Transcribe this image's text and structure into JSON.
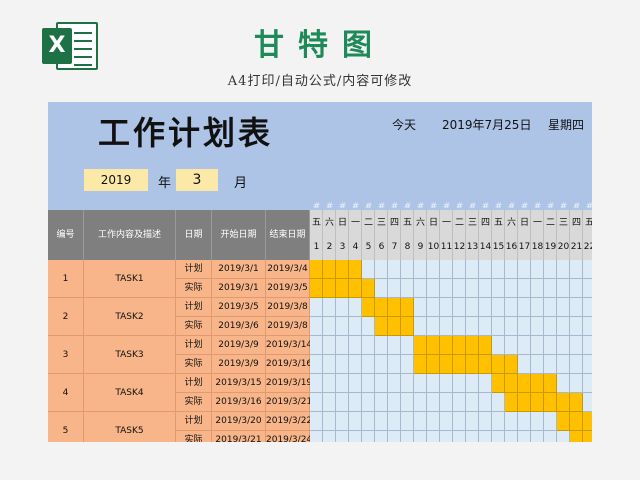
{
  "header": {
    "logo_letter": "X",
    "title": "甘特图",
    "subtitle": "A4打印/自动公式/内容可修改"
  },
  "sheet": {
    "plan_title": "工作计划表",
    "today_label": "今天",
    "today_date": "2019年7月25日",
    "today_weekday": "星期四",
    "year": "2019",
    "year_label": "年",
    "month": "3",
    "month_label": "月",
    "hash_char": "#"
  },
  "columns": {
    "id": "编号",
    "name": "工作内容及描述",
    "type": "日期",
    "start": "开始日期",
    "end": "结束日期"
  },
  "days": {
    "weekdays": [
      "五",
      "六",
      "日",
      "一",
      "二",
      "三",
      "四",
      "五",
      "六",
      "日",
      "一",
      "二",
      "三",
      "四",
      "五",
      "六",
      "日",
      "一",
      "二",
      "三",
      "四",
      "五"
    ],
    "numbers": [
      "1",
      "2",
      "3",
      "4",
      "5",
      "6",
      "7",
      "8",
      "9",
      "10",
      "11",
      "12",
      "13",
      "14",
      "15",
      "16",
      "17",
      "18",
      "19",
      "20",
      "21",
      "22"
    ]
  },
  "tasks": [
    {
      "id": "1",
      "name": "TASK1",
      "plan_label": "计划",
      "actual_label": "实际",
      "plan_start": "2019/3/1",
      "plan_end": "2019/3/4",
      "actual_start": "2019/3/1",
      "actual_end": "2019/3/5"
    },
    {
      "id": "2",
      "name": "TASK2",
      "plan_label": "计划",
      "actual_label": "实际",
      "plan_start": "2019/3/5",
      "plan_end": "2019/3/8",
      "actual_start": "2019/3/6",
      "actual_end": "2019/3/8"
    },
    {
      "id": "3",
      "name": "TASK3",
      "plan_label": "计划",
      "actual_label": "实际",
      "plan_start": "2019/3/9",
      "plan_end": "2019/3/14",
      "actual_start": "2019/3/9",
      "actual_end": "2019/3/16"
    },
    {
      "id": "4",
      "name": "TASK4",
      "plan_label": "计划",
      "actual_label": "实际",
      "plan_start": "2019/3/15",
      "plan_end": "2019/3/19",
      "actual_start": "2019/3/16",
      "actual_end": "2019/3/21"
    },
    {
      "id": "5",
      "name": "TASK5",
      "plan_label": "计划",
      "actual_label": "实际",
      "plan_start": "2019/3/20",
      "plan_end": "2019/3/22",
      "actual_start": "2019/3/21",
      "actual_end": "2019/3/24"
    }
  ],
  "colors": {
    "accent": "#1e8a5a",
    "sheet_bg": "#adc4e6",
    "task_cell": "#f7b589",
    "input_cell": "#fde9a7",
    "bar": "#ffc000",
    "grid_cell": "#ddebf7",
    "header_bg": "#7f7f7f"
  }
}
